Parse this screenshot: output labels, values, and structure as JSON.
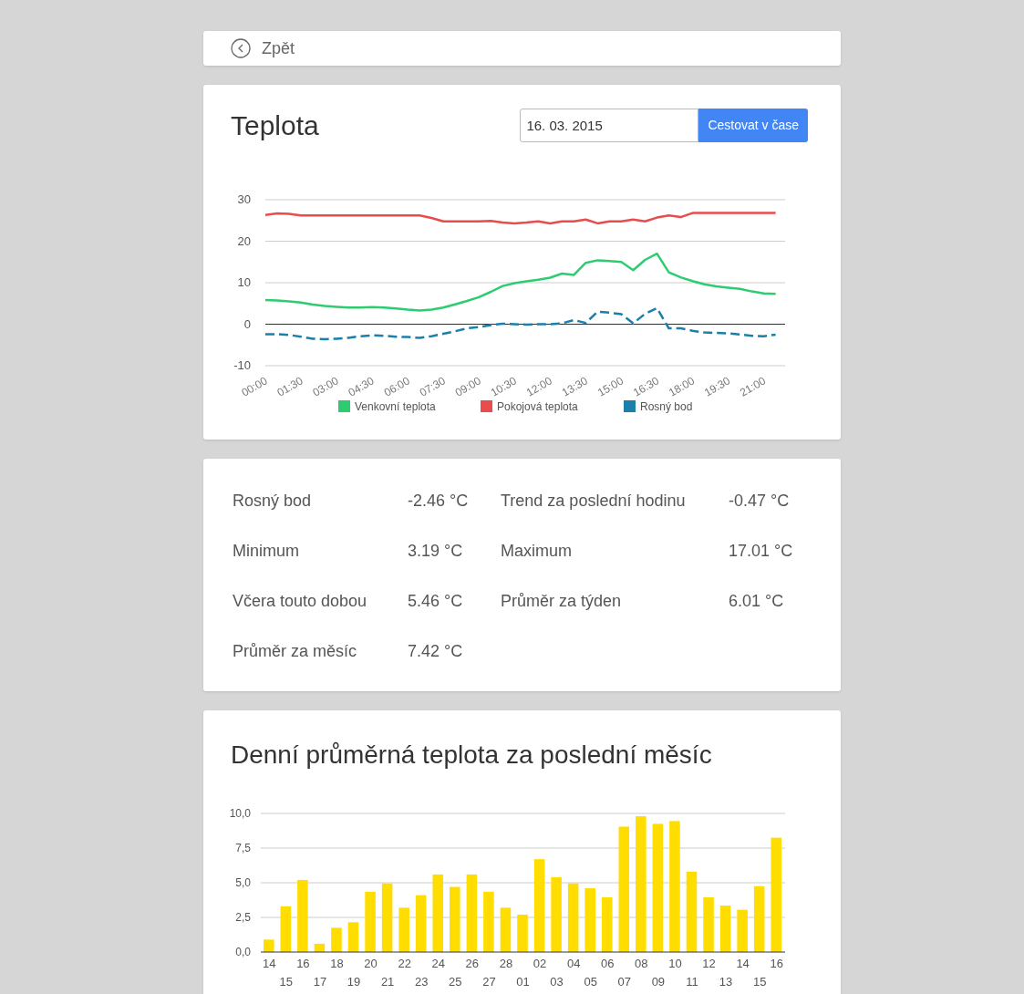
{
  "back_link": {
    "label": "Zpět"
  },
  "temperature_card": {
    "title": "Teplota",
    "date_field": {
      "value": "16. 03. 2015"
    },
    "travel_button": "Cestovat v čase",
    "chart_data": {
      "type": "line",
      "x": [
        0,
        0.5,
        1,
        1.5,
        2,
        2.5,
        3,
        3.5,
        4,
        4.5,
        5,
        5.5,
        6,
        6.5,
        7,
        7.5,
        8,
        8.5,
        9,
        9.5,
        10,
        10.5,
        11,
        11.5,
        12,
        12.5,
        13,
        13.5,
        14,
        14.5,
        15,
        15.5,
        16,
        16.5,
        17,
        17.5,
        18,
        18.5,
        19,
        19.5,
        20,
        20.5,
        21,
        21.5
      ],
      "xlim": [
        0,
        21.9
      ],
      "ylim": [
        -10,
        30
      ],
      "grid": true,
      "legend": "bottom",
      "yticks": [
        -10,
        0,
        10,
        20,
        30
      ],
      "xticks": [
        {
          "value": 0,
          "label": "00:00"
        },
        {
          "value": 1.5,
          "label": "01:30"
        },
        {
          "value": 3,
          "label": "03:00"
        },
        {
          "value": 4.5,
          "label": "04:30"
        },
        {
          "value": 6,
          "label": "06:00"
        },
        {
          "value": 7.5,
          "label": "07:30"
        },
        {
          "value": 9,
          "label": "09:00"
        },
        {
          "value": 10.5,
          "label": "10:30"
        },
        {
          "value": 12,
          "label": "12:00"
        },
        {
          "value": 13.5,
          "label": "13:30"
        },
        {
          "value": 15,
          "label": "15:00"
        },
        {
          "value": 16.5,
          "label": "16:30"
        },
        {
          "value": 18,
          "label": "18:00"
        },
        {
          "value": 19.5,
          "label": "19:30"
        },
        {
          "value": 21,
          "label": "21:00"
        }
      ],
      "series": [
        {
          "name": "Venkovní teplota",
          "color": "#2ecc71",
          "line_style": "solid",
          "values": [
            5.8,
            5.7,
            5.5,
            5.2,
            4.7,
            4.4,
            4.2,
            4.0,
            4.0,
            4.1,
            4.0,
            3.8,
            3.5,
            3.3,
            3.5,
            4.0,
            4.8,
            5.6,
            6.5,
            7.8,
            9.2,
            9.9,
            10.3,
            10.7,
            11.2,
            12.2,
            11.9,
            14.8,
            15.4,
            15.2,
            15.0,
            13.0,
            15.5,
            17.0,
            12.5,
            11.3,
            10.4,
            9.6,
            9.1,
            8.8,
            8.5,
            7.9,
            7.4,
            7.3
          ]
        },
        {
          "name": "Pokojová teplota",
          "color": "#e84c4c",
          "line_style": "solid",
          "values": [
            26.3,
            26.7,
            26.6,
            26.2,
            26.2,
            26.2,
            26.2,
            26.2,
            26.2,
            26.2,
            26.2,
            26.2,
            26.2,
            26.2,
            25.6,
            24.8,
            24.8,
            24.8,
            24.8,
            24.9,
            24.5,
            24.3,
            24.5,
            24.8,
            24.3,
            24.8,
            24.8,
            25.2,
            24.3,
            24.8,
            24.8,
            25.2,
            24.8,
            25.7,
            26.2,
            25.8,
            26.8,
            26.8,
            26.8,
            26.8,
            26.8,
            26.8,
            26.8,
            26.8
          ]
        },
        {
          "name": "Rosný bod",
          "color": "#1a7fab",
          "line_style": "dashed",
          "values": [
            -2.4,
            -2.4,
            -2.6,
            -3.0,
            -3.5,
            -3.6,
            -3.5,
            -3.3,
            -2.9,
            -2.7,
            -2.8,
            -3.0,
            -3.1,
            -3.3,
            -2.9,
            -2.3,
            -1.7,
            -1.0,
            -0.7,
            -0.2,
            0.1,
            0,
            -0.1,
            0,
            0,
            0.2,
            1.0,
            0.3,
            3.0,
            2.8,
            2.4,
            0.2,
            2.5,
            3.9,
            -1.0,
            -1.0,
            -1.6,
            -2.0,
            -2.1,
            -2.2,
            -2.5,
            -2.8,
            -2.9,
            -2.5
          ]
        }
      ]
    }
  },
  "stats": [
    {
      "label": "Rosný bod",
      "value": "-2.46 °C"
    },
    {
      "label": "Trend za poslední hodinu",
      "value": "-0.47 °C"
    },
    {
      "label": "Minimum",
      "value": "3.19 °C"
    },
    {
      "label": "Maximum",
      "value": "17.01 °C"
    },
    {
      "label": "Včera touto dobou",
      "value": "5.46 °C"
    },
    {
      "label": "Průměr za týden",
      "value": "6.01 °C"
    },
    {
      "label": "Průměr za měsíc",
      "value": "7.42 °C"
    }
  ],
  "daily_card": {
    "title": "Denní průměrná teplota za poslední měsíc",
    "chart_data": {
      "type": "bar",
      "ylim": [
        0,
        10
      ],
      "grid": true,
      "yticks": [
        {
          "value": 0,
          "label": "0,0"
        },
        {
          "value": 2.5,
          "label": "2,5"
        },
        {
          "value": 5,
          "label": "5,0"
        },
        {
          "value": 7.5,
          "label": "7,5"
        },
        {
          "value": 10,
          "label": "10,0"
        }
      ],
      "categories": [
        "14",
        "15",
        "16",
        "17",
        "18",
        "19",
        "20",
        "21",
        "22",
        "23",
        "24",
        "25",
        "26",
        "27",
        "28",
        "01",
        "02",
        "03",
        "04",
        "05",
        "06",
        "07",
        "08",
        "09",
        "10",
        "11",
        "12",
        "13",
        "14",
        "15",
        "16"
      ],
      "series": [
        {
          "color": "#ffdd00",
          "values": [
            0.9,
            3.3,
            5.2,
            0.6,
            1.75,
            2.15,
            4.35,
            4.95,
            3.2,
            4.1,
            5.6,
            4.7,
            5.6,
            4.35,
            3.2,
            2.7,
            6.7,
            5.4,
            4.95,
            4.6,
            3.95,
            9.05,
            9.8,
            9.25,
            9.45,
            5.8,
            3.95,
            3.35,
            3.05,
            4.75,
            8.25
          ]
        }
      ]
    }
  }
}
